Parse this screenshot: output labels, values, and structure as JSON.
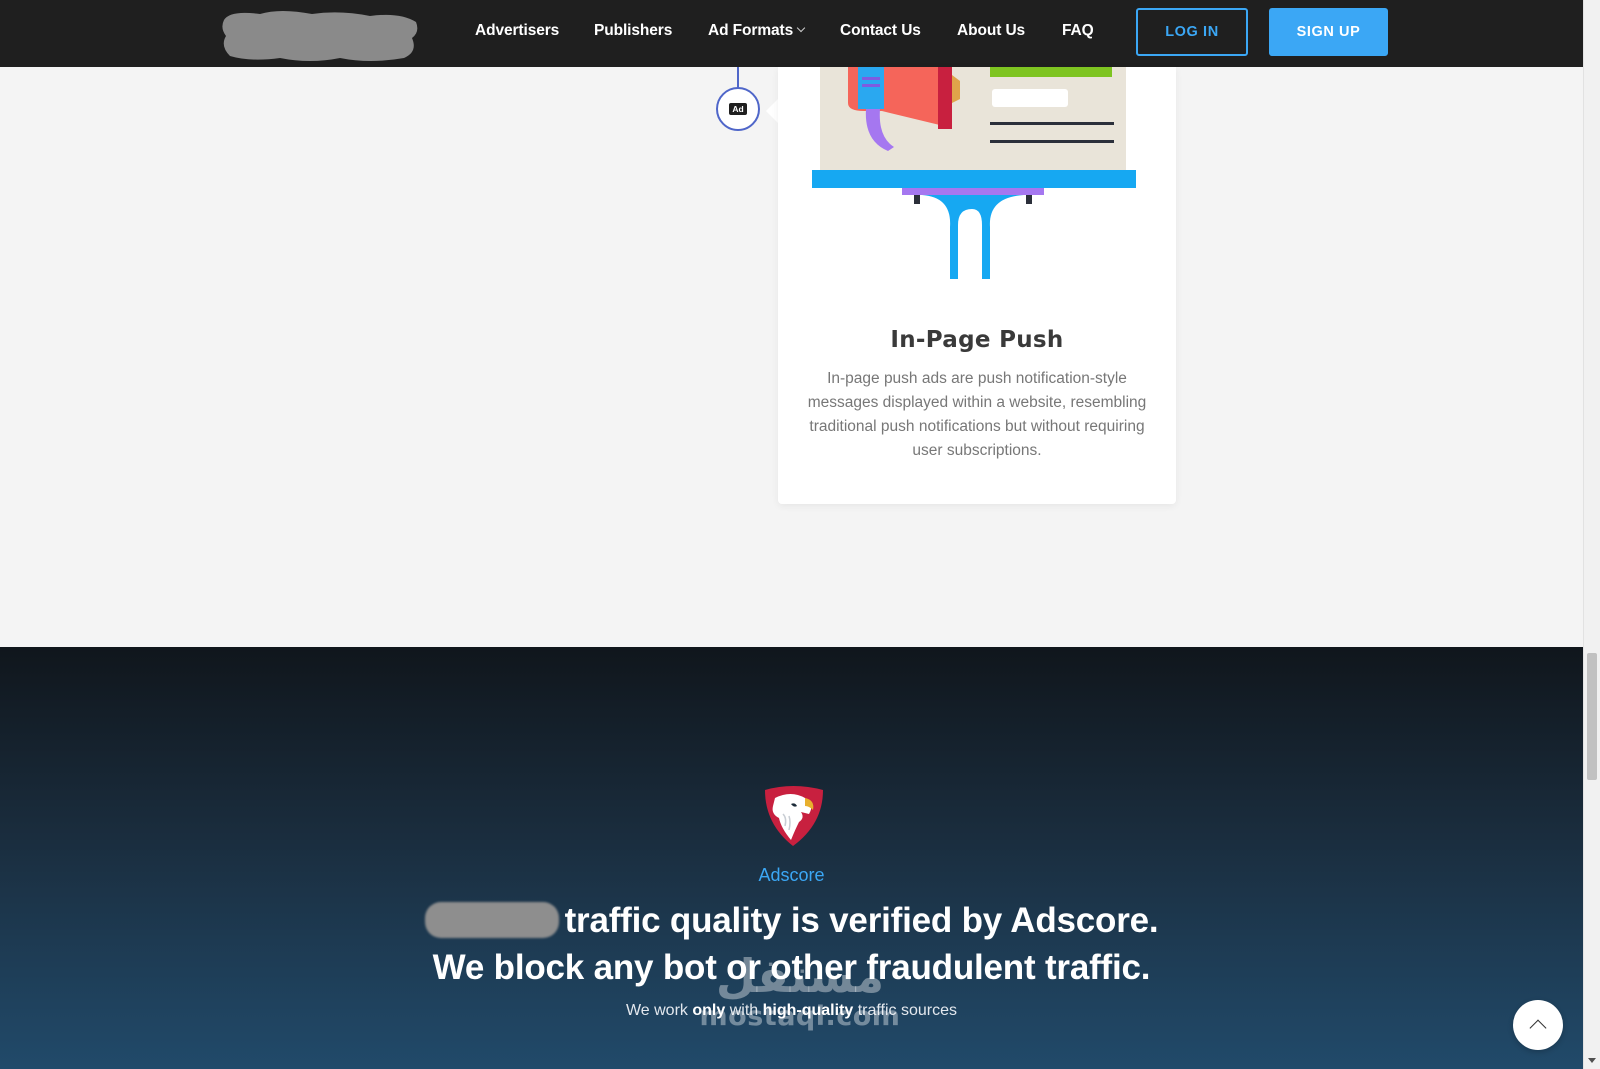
{
  "nav": {
    "items": [
      {
        "label": "Advertisers"
      },
      {
        "label": "Publishers"
      },
      {
        "label": "Ad Formats"
      },
      {
        "label": "Contact Us"
      },
      {
        "label": "About Us"
      },
      {
        "label": "FAQ"
      }
    ],
    "login_label": "LOG IN",
    "signup_label": "SIGN UP"
  },
  "timeline": {
    "marker_label": "Ad"
  },
  "card": {
    "title": "In-Page Push",
    "description": "In-page push ads are push notification-style messages displayed within a website, resembling traditional push notifications but without requiring user subscriptions."
  },
  "adscore": {
    "label": "Adscore",
    "headline_line1": "traffic quality is verified by Adscore.",
    "headline_line2": "We block any bot or other fraudulent traffic.",
    "sub_prefix": "We work",
    "sub_only": "only",
    "sub_with": "with",
    "sub_highquality": "high-quality",
    "sub_suffix": "traffic sources"
  },
  "watermark": {
    "arabic": "مستقل",
    "latin": "mostaql.com"
  },
  "colors": {
    "accent": "#3ba7f5",
    "header_bg": "#1f1f1f",
    "timeline": "#4f66c9",
    "brand_red": "#c8203f"
  }
}
